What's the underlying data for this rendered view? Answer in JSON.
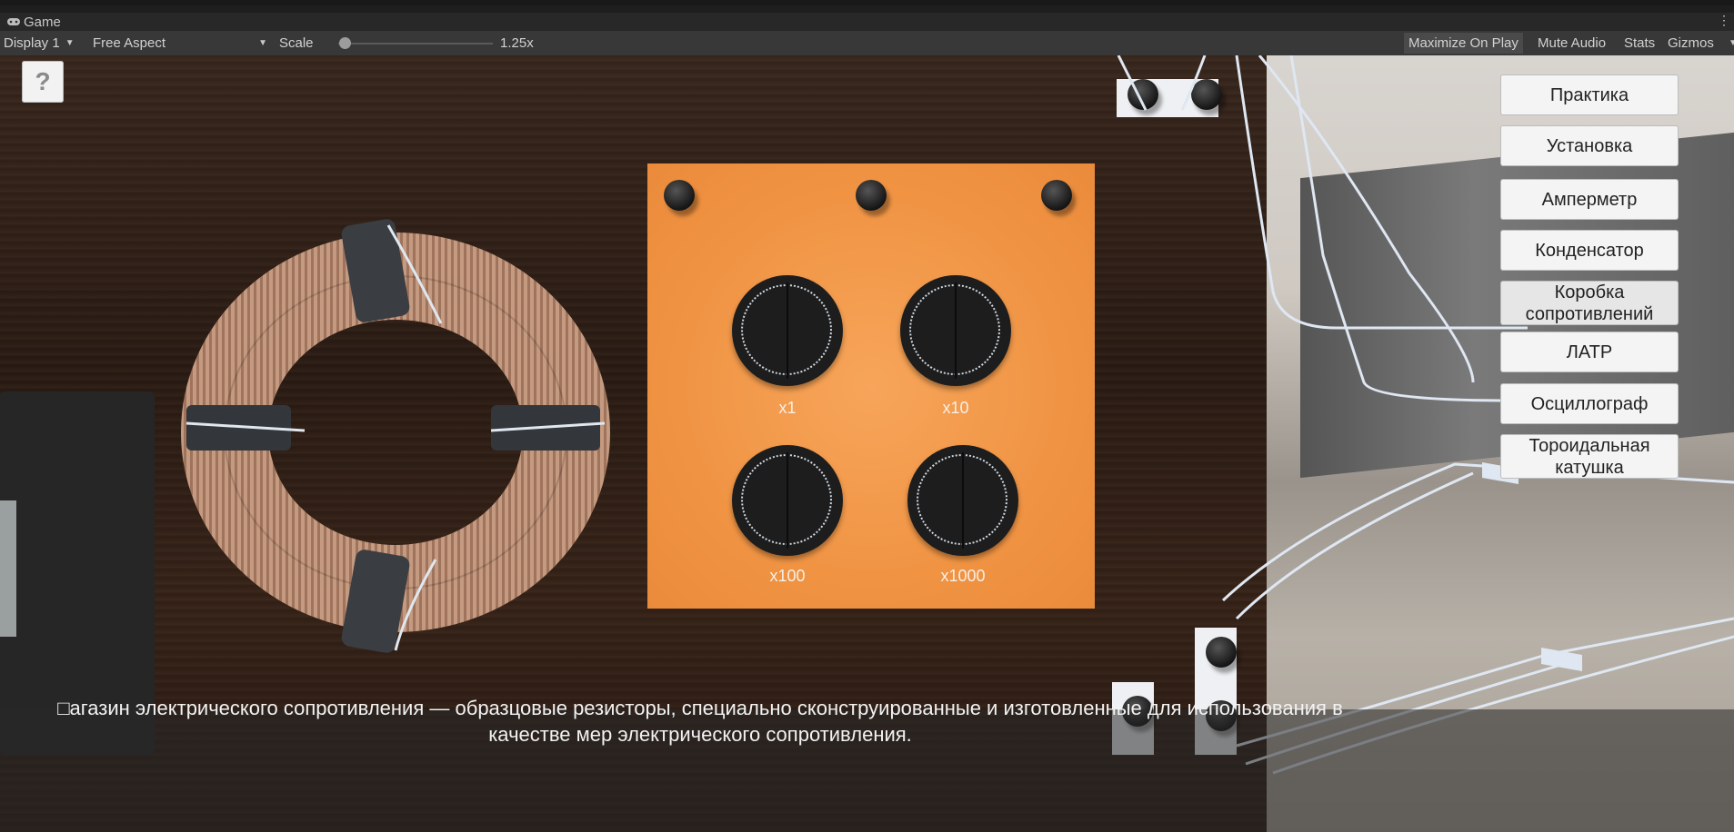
{
  "window": {
    "tab_title": "Game",
    "tab_menu": "⋮"
  },
  "toolbar": {
    "display": "Display 1",
    "aspect": "Free Aspect",
    "scale_label": "Scale",
    "scale_value": "1.25x",
    "scale_fraction": 0.04,
    "maximize": "Maximize On Play",
    "mute": "Mute Audio",
    "stats": "Stats",
    "gizmos": "Gizmos"
  },
  "game": {
    "help_label": "?",
    "knobs": [
      {
        "label": "x1"
      },
      {
        "label": "x10"
      },
      {
        "label": "x100"
      },
      {
        "label": "x1000"
      }
    ],
    "menu": [
      {
        "label": "Практика"
      },
      {
        "label": "Установка"
      },
      {
        "label": "Амперметр"
      },
      {
        "label": "Конденсатор"
      },
      {
        "label": "Коробка сопротивлений"
      },
      {
        "label": "ЛАТР"
      },
      {
        "label": "Осциллограф"
      },
      {
        "label": "Тороидальная катушка"
      }
    ],
    "caption": "□агазин электрического сопротивления — образцовые резисторы, специально сконструированные и изготовленные для использования в качестве мер электрического сопротивления."
  }
}
